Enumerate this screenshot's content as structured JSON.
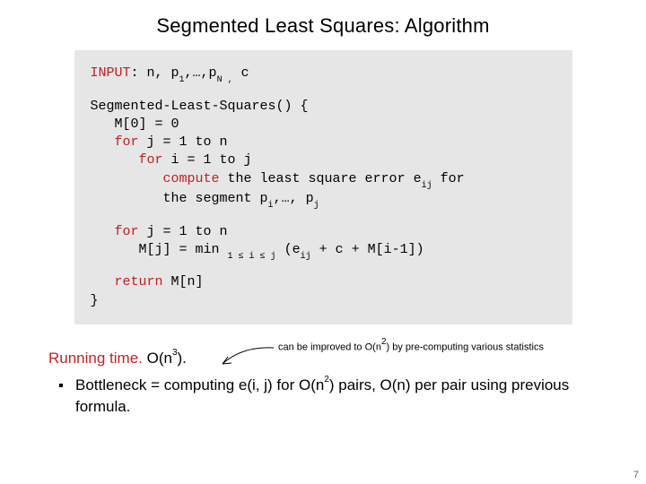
{
  "title": "Segmented Least Squares:  Algorithm",
  "code": {
    "input_kw": "INPUT",
    "input_rest_a": ": n, p",
    "input_sub1": "1",
    "input_rest_b": ",…,p",
    "input_subN": "N ,",
    "input_rest_c": " c",
    "fn_name": "Segmented-Least-Squares() {",
    "m0": "M[0] = 0",
    "for_kw": "for",
    "loop_j1": " j = 1 to n",
    "loop_i": " i = 1 to j",
    "compute_kw": "compute",
    "compute_rest_a": " the least square error e",
    "compute_sub": "ij",
    "compute_rest_b": " for",
    "segline_a": "the segment p",
    "segline_sub1": "i",
    "segline_mid": ",…, p",
    "segline_sub2": "j",
    "loop_j2": " j = 1 to n",
    "mj_a": "M[j] = min ",
    "mj_sub": "1 ≤ i ≤ j",
    "mj_b": " (e",
    "mj_sub2": "ij",
    "mj_c": " + c + M[i-1])",
    "return_kw": "return",
    "return_rest": " M[n]",
    "close": "}"
  },
  "note": {
    "running_label": "Running time.",
    "running_value_a": "  O(n",
    "running_exp": "3",
    "running_value_b": ").",
    "improve": "can be improved to O(n",
    "improve_exp": "2",
    "improve_b": ") by pre-computing various statistics",
    "bottleneck_a": "Bottleneck = computing e(i, j) for O(n",
    "bottleneck_exp": "2",
    "bottleneck_b": ") pairs, O(n) per pair using previous formula."
  },
  "page": "7"
}
